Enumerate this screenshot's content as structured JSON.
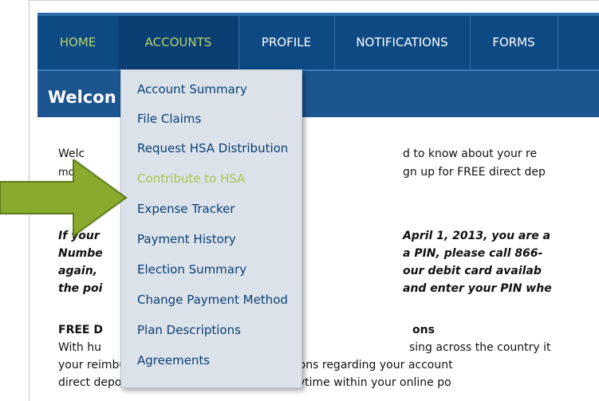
{
  "nav": {
    "items": [
      {
        "label": "HOME"
      },
      {
        "label": "ACCOUNTS"
      },
      {
        "label": "PROFILE"
      },
      {
        "label": "NOTIFICATIONS"
      },
      {
        "label": "FORMS"
      }
    ]
  },
  "welcome_title": "Welcon",
  "dropdown": {
    "items": [
      {
        "label": "Account Summary"
      },
      {
        "label": "File Claims"
      },
      {
        "label": "Request HSA Distribution"
      },
      {
        "label": "Contribute to HSA"
      },
      {
        "label": "Expense Tracker"
      },
      {
        "label": "Payment History"
      },
      {
        "label": "Election Summary"
      },
      {
        "label": "Change Payment Method"
      },
      {
        "label": "Plan Descriptions"
      },
      {
        "label": "Agreements"
      }
    ],
    "highlighted_index": 3
  },
  "content": {
    "left": [
      "Welc",
      "mobil",
      "If your",
      "Numbe",
      "again,",
      "the poi",
      "FREE D",
      "With hu"
    ],
    "right": [
      "d to know about your re",
      "gn up for FREE direct dep",
      "April 1, 2013, you are a",
      "a PIN, please call 866-",
      "our debit card availab",
      "and enter your PIN whe",
      "ons",
      "sing across the country it"
    ],
    "line_reimb": "your reimbursement or important notifications regarding your account",
    "line_direct": "direct deposit and email notifications at anytime within your online po"
  },
  "colors": {
    "nav_bg": "#0d4a84",
    "nav_active_text": "#b6d46a",
    "dropdown_bg": "#dbe2ea",
    "dropdown_text": "#0c3f73",
    "dropdown_highlight_text": "#a8c54c",
    "arrow_fill": "#8aaa2e"
  },
  "icons": {
    "pointer": "green-arrow-icon"
  }
}
